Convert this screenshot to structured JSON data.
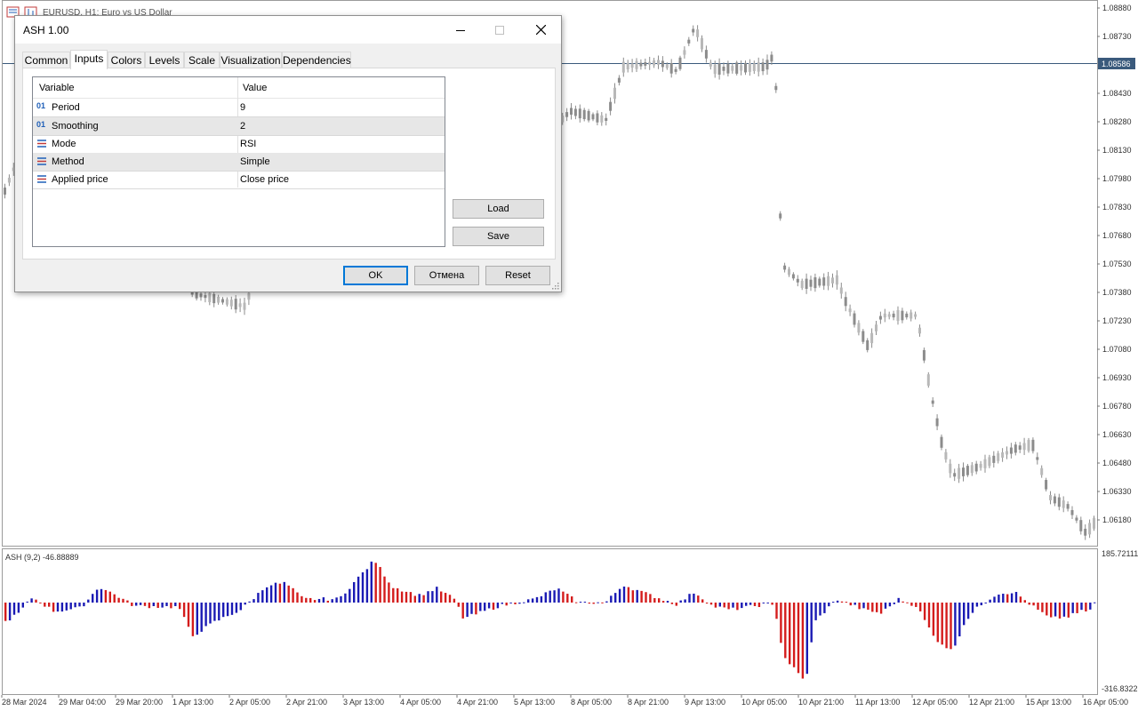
{
  "window": {
    "symbol_title": "EURUSD, H1:  Euro vs US Dollar"
  },
  "price_axis": {
    "labels": [
      "1.08880",
      "1.08730",
      "1.08586",
      "1.08430",
      "1.08280",
      "1.08130",
      "1.07980",
      "1.07830",
      "1.07680",
      "1.07530",
      "1.07380",
      "1.07230",
      "1.07080",
      "1.06930",
      "1.06780",
      "1.06630",
      "1.06480",
      "1.06330",
      "1.06180"
    ],
    "current_price": "1.08586",
    "current_price_color": "#3a5a7c"
  },
  "indicator": {
    "label": "ASH (9,2) -46.88889",
    "max_label": "185.72111",
    "min_label": "-316.8322",
    "bull_color": "#1a1ab4",
    "bear_color": "#d41c1c"
  },
  "time_axis": {
    "labels": [
      "28 Mar 2024",
      "29 Mar 04:00",
      "29 Mar 20:00",
      "1 Apr 13:00",
      "2 Apr 05:00",
      "2 Apr 21:00",
      "3 Apr 13:00",
      "4 Apr 05:00",
      "4 Apr 21:00",
      "5 Apr 13:00",
      "8 Apr 05:00",
      "8 Apr 21:00",
      "9 Apr 13:00",
      "10 Apr 05:00",
      "10 Apr 21:00",
      "11 Apr 13:00",
      "12 Apr 05:00",
      "12 Apr 21:00",
      "15 Apr 13:00",
      "16 Apr 05:00"
    ]
  },
  "dialog": {
    "title": "ASH 1.00",
    "tabs": [
      "Common",
      "Inputs",
      "Colors",
      "Levels",
      "Scale",
      "Visualization",
      "Dependencies"
    ],
    "active_tab": "Inputs",
    "columns": {
      "variable": "Variable",
      "value": "Value"
    },
    "inputs": [
      {
        "icon": "int-icon",
        "name": "Period",
        "value": "9"
      },
      {
        "icon": "int-icon",
        "name": "Smoothing",
        "value": "2"
      },
      {
        "icon": "enum-icon",
        "name": "Mode",
        "value": "RSI"
      },
      {
        "icon": "enum-icon",
        "name": "Method",
        "value": "Simple"
      },
      {
        "icon": "enum-icon",
        "name": "Applied price",
        "value": "Close price"
      }
    ],
    "buttons": {
      "load": "Load",
      "save": "Save",
      "ok": "OK",
      "cancel": "Отмена",
      "reset": "Reset"
    }
  }
}
